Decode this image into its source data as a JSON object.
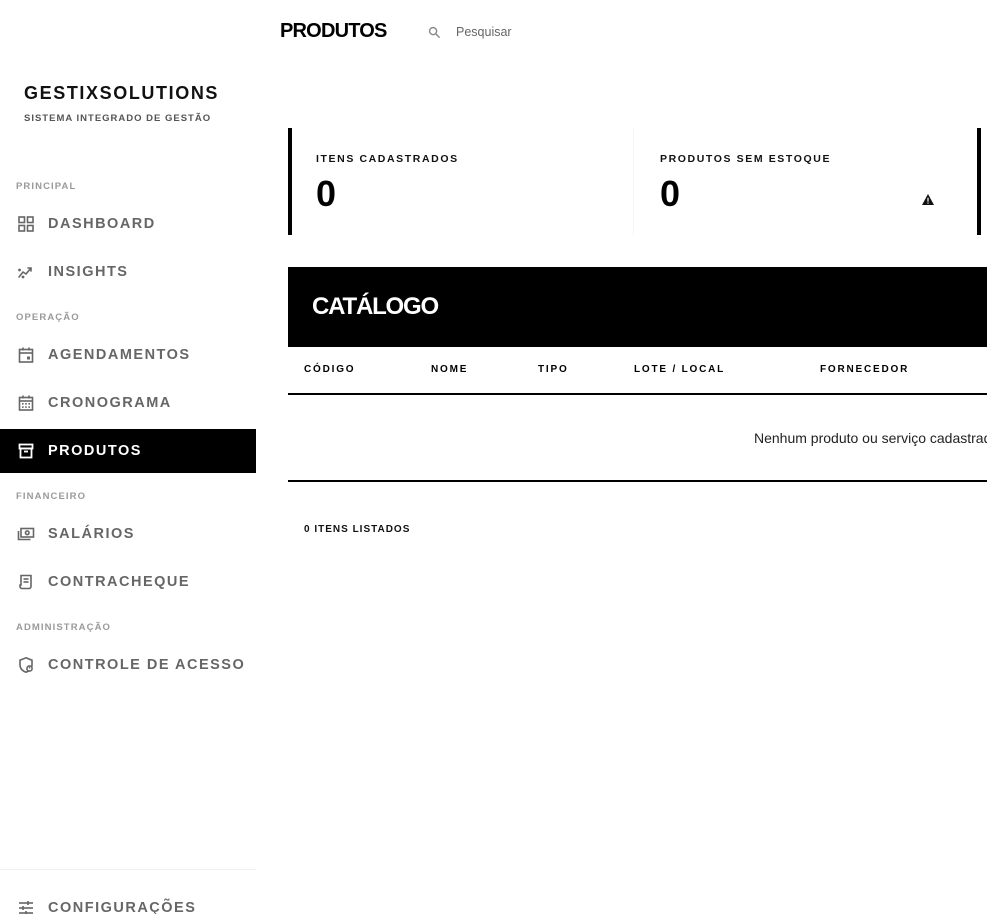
{
  "app": {
    "brand": "GESTIXSOLUTIONS",
    "subtitle": "SISTEMA INTEGRADO DE GESTÃO"
  },
  "sidebar": {
    "sections": [
      {
        "label": "PRINCIPAL"
      },
      {
        "label": "OPERAÇÃO"
      },
      {
        "label": "FINANCEIRO"
      },
      {
        "label": "ADMINISTRAÇÃO"
      }
    ],
    "items": [
      {
        "label": "DASHBOARD",
        "icon": "grid-icon"
      },
      {
        "label": "INSIGHTS",
        "icon": "trend-icon"
      },
      {
        "label": "AGENDAMENTOS",
        "icon": "calendar-event-icon"
      },
      {
        "label": "CRONOGRAMA",
        "icon": "calendar-month-icon"
      },
      {
        "label": "PRODUTOS",
        "icon": "archive-box-icon",
        "active": true
      },
      {
        "label": "SALÁRIOS",
        "icon": "payments-icon"
      },
      {
        "label": "CONTRACHEQUE",
        "icon": "receipt-icon"
      },
      {
        "label": "CONTROLE DE ACESSO",
        "icon": "shield-person-icon"
      }
    ],
    "footer_item": {
      "label": "CONFIGURAÇÕES",
      "icon": "sliders-icon"
    }
  },
  "header": {
    "title": "PRODUTOS",
    "search_placeholder": "Pesquisar"
  },
  "stats": [
    {
      "label": "ITENS CADASTRADOS",
      "value": "0"
    },
    {
      "label": "PRODUTOS SEM ESTOQUE",
      "value": "0",
      "icon": "warning-icon"
    }
  ],
  "catalog": {
    "title": "CATÁLOGO",
    "columns": [
      "CÓDIGO",
      "NOME",
      "TIPO",
      "LOTE / LOCAL",
      "FORNECEDOR"
    ],
    "empty_message": "Nenhum produto ou serviço cadastrado.",
    "count_text": "0 ITENS LISTADOS"
  },
  "colors": {
    "accent": "#000000",
    "muted_text": "#666666",
    "section_label": "#9a9a9a"
  }
}
